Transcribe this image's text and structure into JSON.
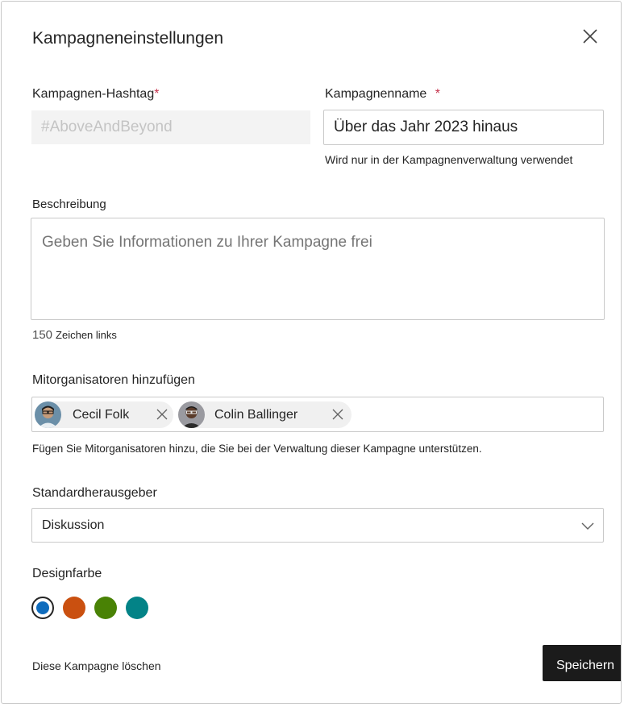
{
  "dialog": {
    "title": "Kampagneneinstellungen"
  },
  "hashtag": {
    "label": "Kampagnen-Hashtag",
    "required_mark": "*",
    "value": "#AboveAndBeyond"
  },
  "campaign_name": {
    "label": "Kampagnenname",
    "required_mark": "*",
    "value": "Über das Jahr 2023 hinaus",
    "hint": "Wird nur in der Kampagnenverwaltung verwendet"
  },
  "description": {
    "label": "Beschreibung",
    "placeholder": "Geben Sie Informationen zu Ihrer Kampagne frei",
    "chars_count": "150",
    "chars_label": "Zeichen links"
  },
  "coorganizers": {
    "label": "Mitorganisatoren hinzufügen",
    "people": [
      {
        "name": "Cecil  Folk"
      },
      {
        "name": "Colin Ballinger"
      }
    ],
    "hint": "Fügen Sie Mitorganisatoren hinzu, die Sie bei der Verwaltung dieser Kampagne unterstützen."
  },
  "publisher": {
    "label": "Standardherausgeber",
    "selected": "Diskussion"
  },
  "theme": {
    "label": "Designfarbe",
    "colors": [
      "#0f6cbd",
      "#ca5010",
      "#498205",
      "#038387"
    ],
    "selected_index": 0
  },
  "footer": {
    "delete_label": "Diese Kampagne löschen",
    "save_label": "Speichern"
  },
  "icons": {
    "close": "close-icon",
    "chip_remove": "dismiss-icon",
    "dropdown": "chevron-down-icon"
  }
}
